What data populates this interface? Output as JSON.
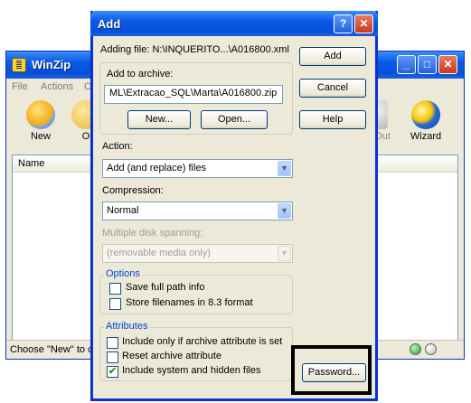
{
  "background_window": {
    "title": "WinZip",
    "menu": [
      "File",
      "Actions",
      "Op"
    ],
    "toolbar": [
      {
        "label": "New",
        "icon": "new-archive-icon"
      },
      {
        "label": "O",
        "icon": "open-archive-icon"
      },
      {
        "label": "Out",
        "icon": "checkout-icon"
      },
      {
        "label": "Wizard",
        "icon": "wizard-icon"
      }
    ],
    "list_header": "Name",
    "status_text": "Choose \"New\" to c"
  },
  "dialog": {
    "title": "Add",
    "help_glyph": "?",
    "close_glyph": "✕",
    "adding_file": "Adding file: N:\\INQUERITO...\\A016800.xml",
    "add_to_archive_label": "Add to archive:",
    "archive_path": "ML\\Extracao_SQL\\Marta\\A016800.zip",
    "new_button": "New...",
    "open_button": "Open...",
    "add_button": "Add",
    "cancel_button": "Cancel",
    "help_button": "Help",
    "action_label": "Action:",
    "action_value": "Add (and replace) files",
    "compression_label": "Compression:",
    "compression_value": "Normal",
    "spanning_label": "Multiple disk spanning:",
    "spanning_value": "(removable media only)",
    "options_caption": "Options",
    "options": [
      {
        "label": "Save full path info",
        "checked": false
      },
      {
        "label": "Store filenames in 8.3 format",
        "checked": false
      }
    ],
    "attributes_caption": "Attributes",
    "attributes": [
      {
        "label": "Include only if archive attribute is set",
        "checked": false
      },
      {
        "label": "Reset archive attribute",
        "checked": false
      },
      {
        "label": "Include system and hidden files",
        "checked": true
      }
    ],
    "password_button": "Password...",
    "check_glyph": "✔"
  },
  "colors": {
    "accent": "#0831d9",
    "title_bar": "#0a5ae6",
    "highlight_box": "#000000"
  }
}
